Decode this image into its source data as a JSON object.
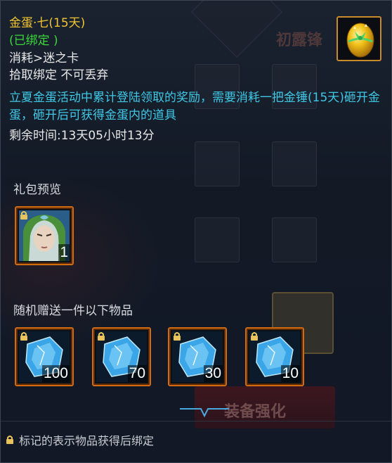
{
  "item": {
    "name": "金蛋·七(15天)",
    "bound": "(已绑定 )",
    "consume": "消耗>迷之卡",
    "pickup": "拾取绑定 不可丢弃",
    "description": "立夏金蛋活动中累计登陆领取的奖励，需要消耗一把金锤(15天)砸开金蛋，砸开后可获得金蛋内的道具",
    "remaining": "剩余时间:13天05小时13分",
    "icon": "golden-egg-icon"
  },
  "gift_preview": {
    "label": "礼包预览",
    "items": [
      {
        "icon": "character-portrait-icon",
        "qty": "1"
      }
    ]
  },
  "random_gift": {
    "label": "随机赠送一件以下物品",
    "items": [
      {
        "icon": "blue-crystal-icon",
        "qty": "100"
      },
      {
        "icon": "blue-crystal-icon",
        "qty": "70"
      },
      {
        "icon": "blue-crystal-icon",
        "qty": "30"
      },
      {
        "icon": "blue-crystal-icon",
        "qty": "10"
      }
    ]
  },
  "footer": {
    "note": "标记的表示物品获得后绑定"
  },
  "background": {
    "button_text": "装备强化",
    "side_text": "初露锋"
  },
  "colors": {
    "title": "#f0c430",
    "bound": "#39d839",
    "description": "#3ec8e6",
    "slot_border": "#d26a12"
  }
}
